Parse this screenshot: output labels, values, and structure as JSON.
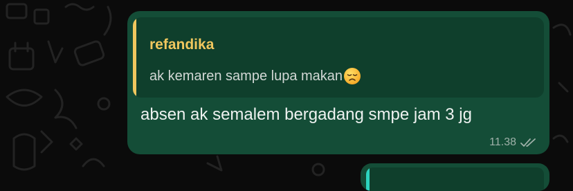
{
  "chat": {
    "messages": [
      {
        "reply_to": {
          "author": "refandika",
          "text": "ak kemaren sampe lupa makan",
          "emoji_icon": "disappointed-face-icon"
        },
        "text": "absen ak semalem bergadang smpe jam 3 jg",
        "time": "11.38",
        "status_icon": "double-check-icon"
      }
    ]
  },
  "colors": {
    "background": "#0b0b0b",
    "bubble": "#144d37",
    "quote_bg": "#0f3f2c",
    "quote_accent": "#f0c75e",
    "next_quote_accent": "#2dd4bf"
  }
}
